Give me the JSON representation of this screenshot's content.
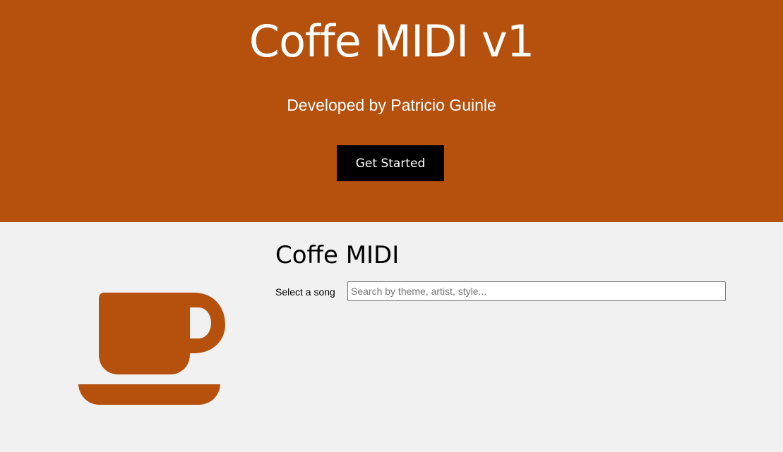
{
  "hero": {
    "title": "Coffe MIDI v1",
    "subtitle": "Developed by Patricio Guinle",
    "cta_label": "Get Started",
    "background_color": "#b5500d"
  },
  "main": {
    "icon": "coffee-cup-icon",
    "icon_color": "#b5500d",
    "title": "Coffe MIDI",
    "song_label": "Select a song",
    "search": {
      "placeholder": "Search by theme, artist, style...",
      "value": ""
    }
  }
}
